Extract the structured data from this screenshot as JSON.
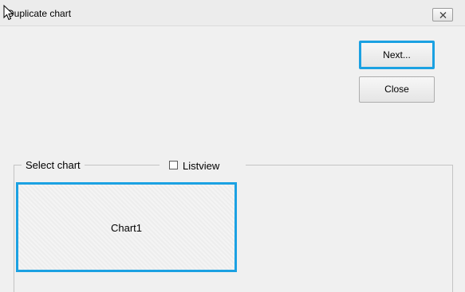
{
  "window": {
    "title": "Duplicate chart"
  },
  "buttons": {
    "next_label": "Next...",
    "close_label": "Close"
  },
  "select_group": {
    "label": "Select chart",
    "listview_label": "Listview",
    "listview_checked": false
  },
  "charts": [
    {
      "label": "Chart1"
    }
  ],
  "colors": {
    "focus_border": "#1ba1e2",
    "window_bg": "#f0f0f0"
  },
  "icons": {
    "title_close": "close-icon",
    "cursor": "mouse-pointer-icon"
  }
}
